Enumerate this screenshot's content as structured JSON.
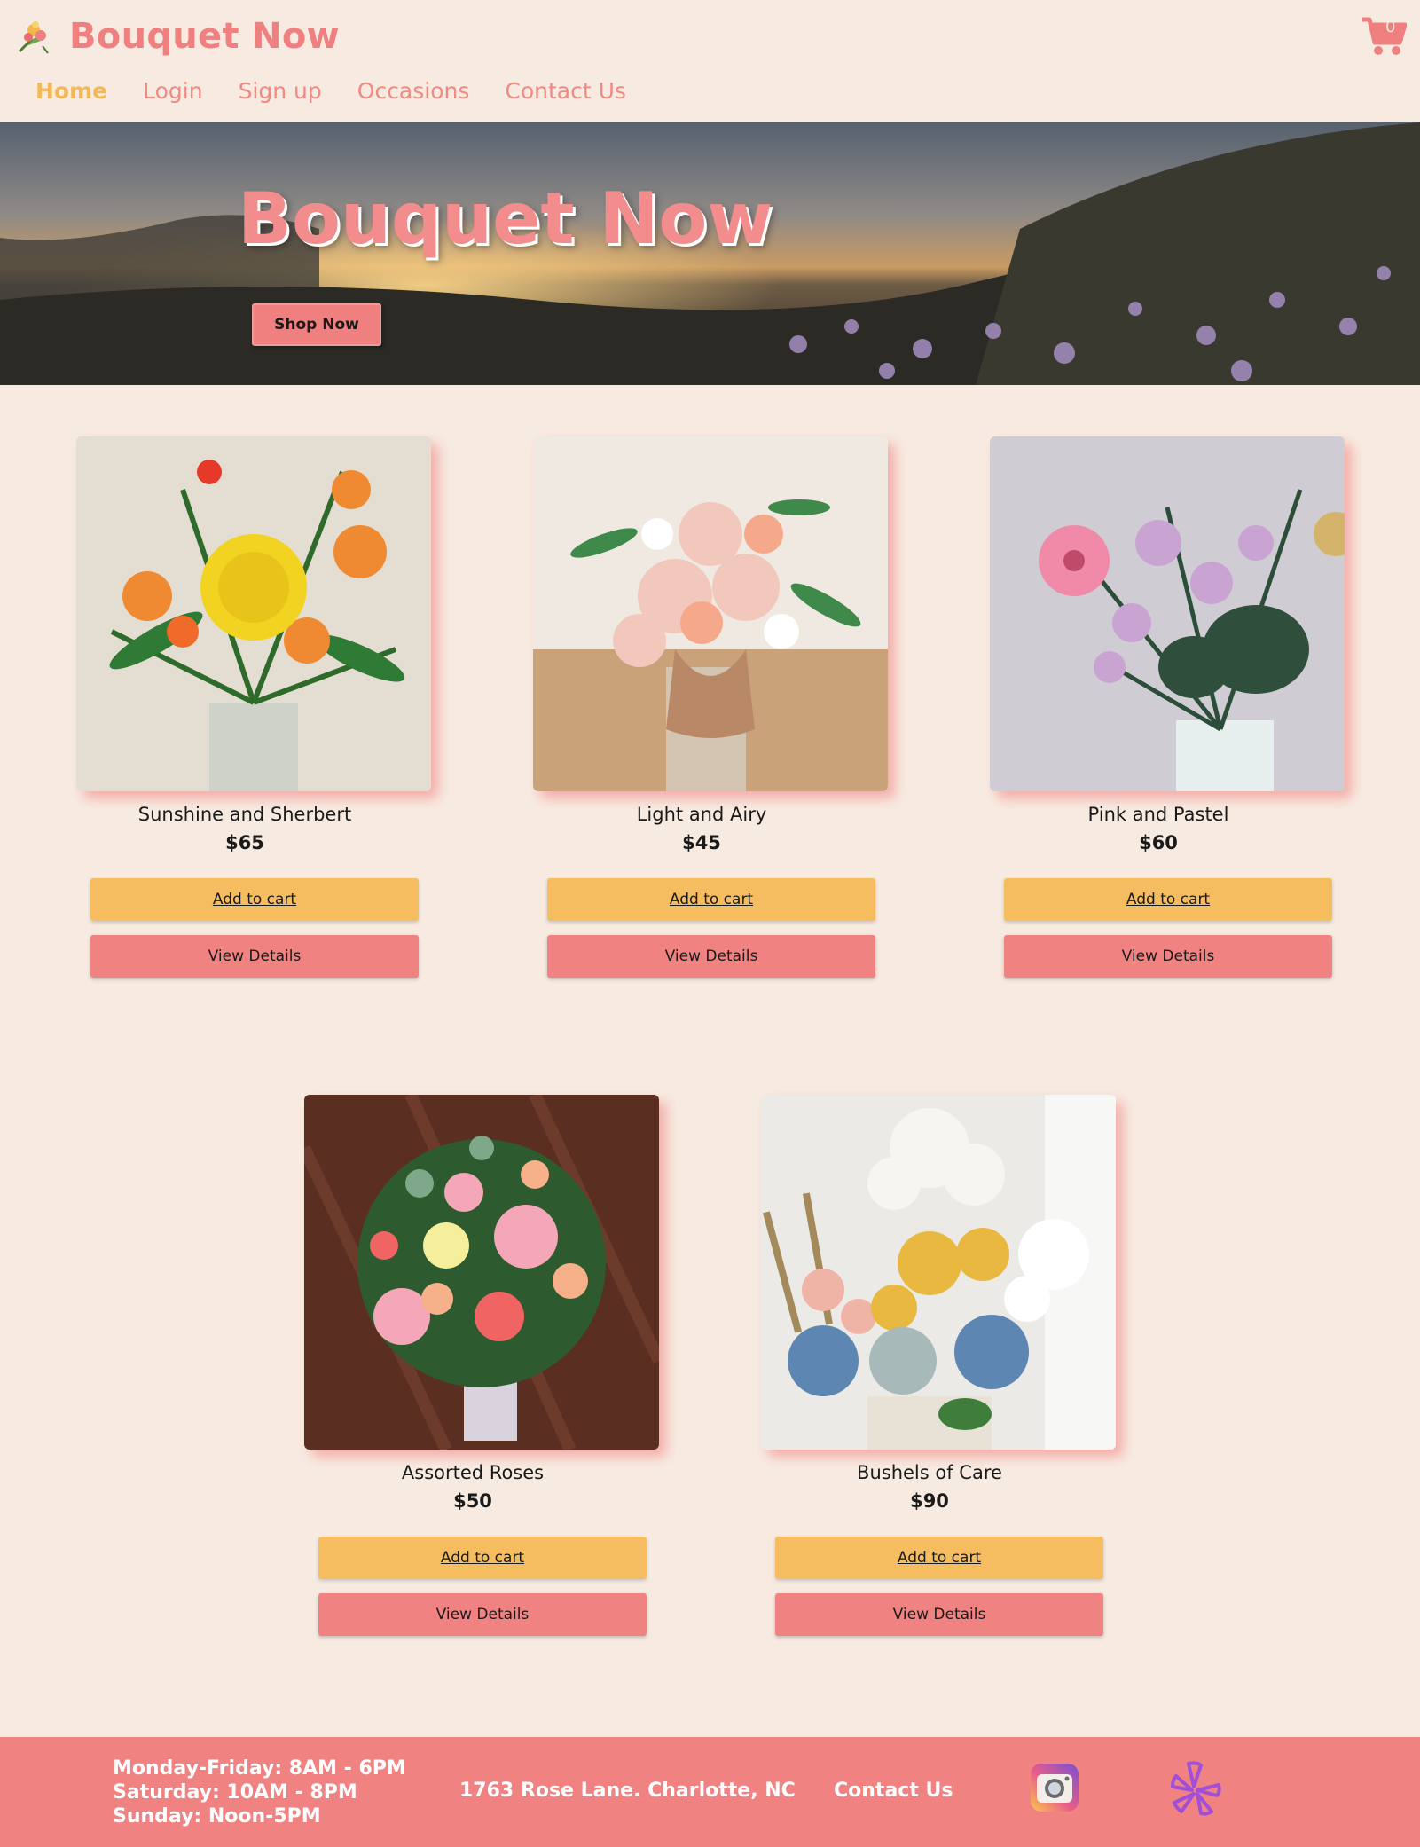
{
  "header": {
    "brand": "Bouquet Now",
    "cart_count": "0",
    "nav": [
      {
        "label": "Home",
        "active": true
      },
      {
        "label": "Login",
        "active": false
      },
      {
        "label": "Sign up",
        "active": false
      },
      {
        "label": "Occasions",
        "active": false
      },
      {
        "label": "Contact Us",
        "active": false
      }
    ]
  },
  "hero": {
    "title": "Bouquet Now",
    "button": "Shop Now"
  },
  "products": [
    {
      "name": "Sunshine and Sherbert",
      "price": "$65",
      "add_label": "Add to cart",
      "details_label": "View Details"
    },
    {
      "name": "Light and Airy",
      "price": "$45",
      "add_label": "Add to cart",
      "details_label": "View Details"
    },
    {
      "name": "Pink and Pastel",
      "price": "$60",
      "add_label": "Add to cart",
      "details_label": "View Details"
    },
    {
      "name": "Assorted Roses",
      "price": "$50",
      "add_label": "Add to cart",
      "details_label": "View Details"
    },
    {
      "name": "Bushels of Care",
      "price": "$90",
      "add_label": "Add to cart",
      "details_label": "View Details"
    }
  ],
  "footer": {
    "hours": [
      "Monday-Friday: 8AM - 6PM",
      "Saturday: 10AM - 8PM",
      "Sunday: Noon-5PM"
    ],
    "address": "1763 Rose Lane. Charlotte, NC",
    "contact": "Contact Us"
  },
  "colors": {
    "background": "#f7ebe1",
    "brand_pink": "#f08080",
    "accent_yellow": "#f5bd5f",
    "footer_bg": "#f08282"
  },
  "icons": [
    "bouquet-logo-icon",
    "shopping-cart-icon",
    "instagram-icon",
    "yelp-icon"
  ]
}
